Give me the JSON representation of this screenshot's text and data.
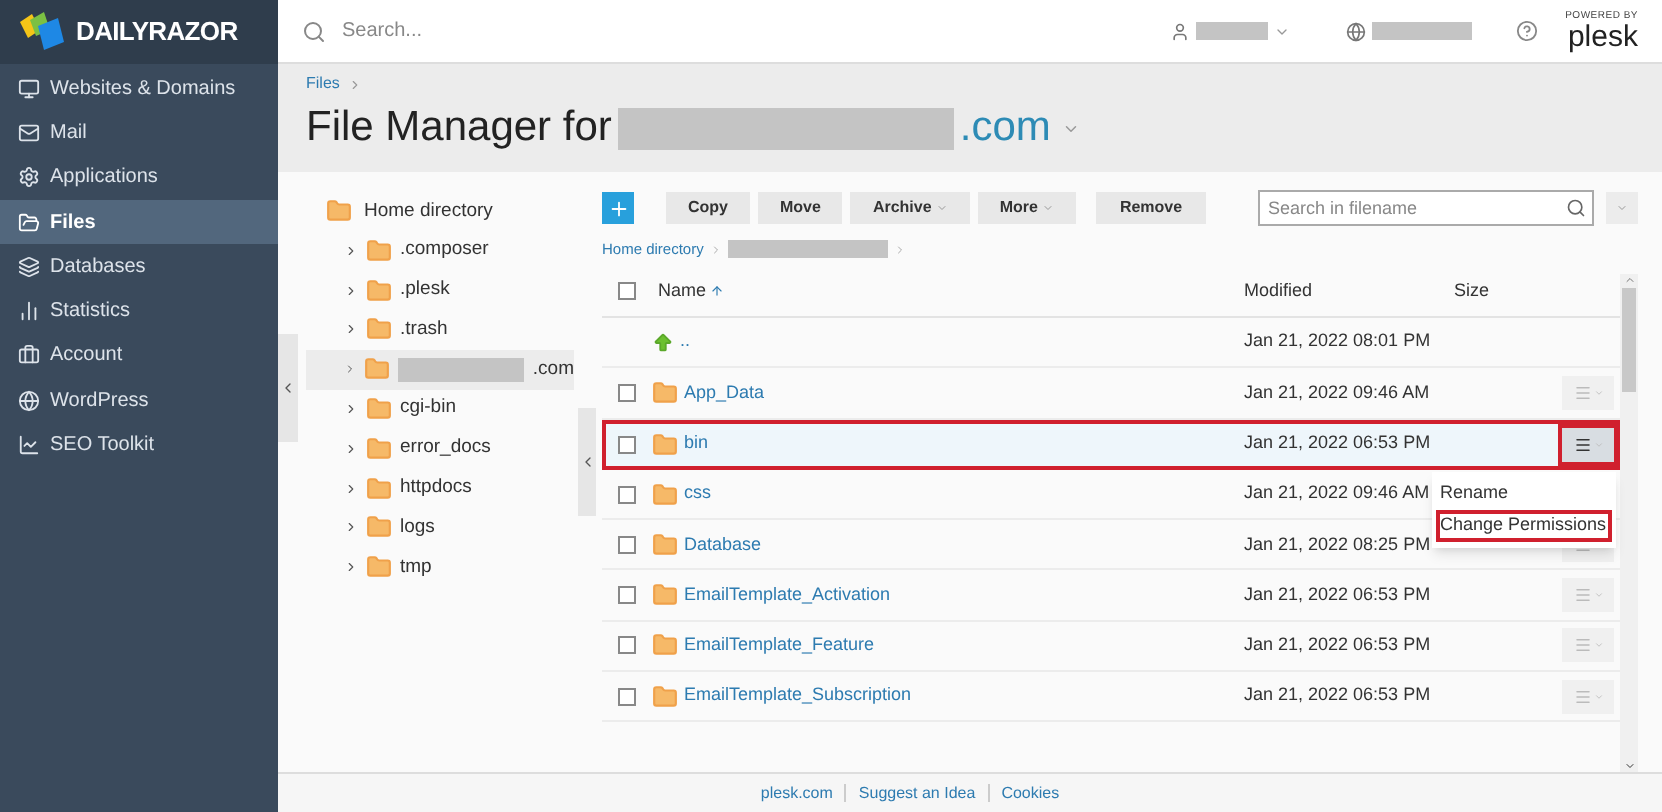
{
  "brand": {
    "name": "DAILYRAZOR"
  },
  "sidebar": {
    "items": [
      {
        "label": "Websites & Domains",
        "selected": false
      },
      {
        "label": "Mail",
        "selected": false
      },
      {
        "label": "Applications",
        "selected": false
      },
      {
        "label": "Files",
        "selected": true
      },
      {
        "label": "Databases",
        "selected": false
      },
      {
        "label": "Statistics",
        "selected": false
      },
      {
        "label": "Account",
        "selected": false
      },
      {
        "label": "WordPress",
        "selected": false
      },
      {
        "label": "SEO Toolkit",
        "selected": false
      }
    ]
  },
  "topbar": {
    "search_placeholder": "Search...",
    "powered_by": "POWERED BY",
    "logo": "plesk"
  },
  "header": {
    "breadcrumb": "Files",
    "title": "File Manager for",
    "domain_suffix": ".com"
  },
  "tree": {
    "root": "Home directory",
    "children": [
      {
        "label": ".composer",
        "selected": false,
        "redacted": false
      },
      {
        "label": ".plesk",
        "selected": false,
        "redacted": false
      },
      {
        "label": ".trash",
        "selected": false,
        "redacted": false
      },
      {
        "label": ".com",
        "selected": true,
        "redacted": true
      },
      {
        "label": "cgi-bin",
        "selected": false,
        "redacted": false
      },
      {
        "label": "error_docs",
        "selected": false,
        "redacted": false
      },
      {
        "label": "httpdocs",
        "selected": false,
        "redacted": false
      },
      {
        "label": "logs",
        "selected": false,
        "redacted": false
      },
      {
        "label": "tmp",
        "selected": false,
        "redacted": false
      }
    ]
  },
  "toolbar": {
    "buttons": [
      {
        "label": "Copy",
        "dropdown": false
      },
      {
        "label": "Move",
        "dropdown": false
      },
      {
        "label": "Archive",
        "dropdown": true
      },
      {
        "label": "More",
        "dropdown": true
      },
      {
        "label": "Remove",
        "dropdown": false
      }
    ],
    "search_placeholder": "Search in filename"
  },
  "path": {
    "root": "Home directory"
  },
  "table": {
    "columns": [
      {
        "label": "Name",
        "sorted": true
      },
      {
        "label": "Modified",
        "sorted": false
      },
      {
        "label": "Size",
        "sorted": false
      }
    ],
    "header_checked": false,
    "rows": [
      {
        "kind": "parent",
        "name": "..",
        "modified": "Jan 21, 2022 08:01 PM",
        "selected": false
      },
      {
        "kind": "folder",
        "name": "App_Data",
        "modified": "Jan 21, 2022 09:46 AM",
        "selected": false,
        "checked": false,
        "menu_open": false
      },
      {
        "kind": "folder",
        "name": "bin",
        "modified": "Jan 21, 2022 06:53 PM",
        "selected": true,
        "checked": false,
        "menu_open": true
      },
      {
        "kind": "folder",
        "name": "css",
        "modified": "Jan 21, 2022 09:46 AM",
        "selected": false,
        "checked": false,
        "menu_open": false
      },
      {
        "kind": "folder",
        "name": "Database",
        "modified": "Jan 21, 2022 08:25 PM",
        "selected": false,
        "checked": false,
        "menu_open": false
      },
      {
        "kind": "folder",
        "name": "EmailTemplate_Activation",
        "modified": "Jan 21, 2022 06:53 PM",
        "selected": false,
        "checked": false,
        "menu_open": false
      },
      {
        "kind": "folder",
        "name": "EmailTemplate_Feature",
        "modified": "Jan 21, 2022 06:53 PM",
        "selected": false,
        "checked": false,
        "menu_open": false
      },
      {
        "kind": "folder",
        "name": "EmailTemplate_Subscription",
        "modified": "Jan 21, 2022 06:53 PM",
        "selected": false,
        "checked": false,
        "menu_open": false
      }
    ]
  },
  "context_menu": {
    "items": [
      {
        "label": "Rename",
        "highlighted": false
      },
      {
        "label": "Change Permissions",
        "highlighted": true
      }
    ]
  },
  "footer": {
    "links": [
      "plesk.com",
      "Suggest an Idea",
      "Cookies"
    ]
  }
}
